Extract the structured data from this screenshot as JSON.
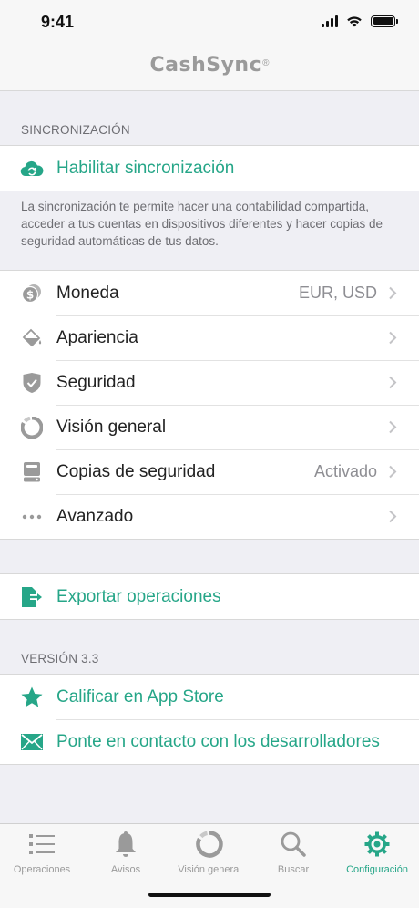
{
  "status_bar": {
    "time": "9:41"
  },
  "header": {
    "title": "CashSync",
    "registered_mark": "®"
  },
  "sync_section": {
    "header": "SINCRONIZACIÓN",
    "enable_label": "Habilitar sincronización",
    "note": "La sincronización te permite hacer una contabilidad compartida, acceder a tus cuentas en dispositivos diferentes y hacer copias de seguridad automáticas de tus datos."
  },
  "settings": {
    "items": [
      {
        "label": "Moneda",
        "value": "EUR, USD",
        "icon": "currency-icon"
      },
      {
        "label": "Apariencia",
        "value": "",
        "icon": "paint-bucket-icon"
      },
      {
        "label": "Seguridad",
        "value": "",
        "icon": "shield-icon"
      },
      {
        "label": "Visión general",
        "value": "",
        "icon": "overview-ring-icon"
      },
      {
        "label": "Copias de seguridad",
        "value": "Activado",
        "icon": "backup-drive-icon"
      },
      {
        "label": "Avanzado",
        "value": "",
        "icon": "more-dots-icon"
      }
    ]
  },
  "export": {
    "label": "Exportar operaciones",
    "icon": "export-icon"
  },
  "version_section": {
    "header": "VERSIÓN 3.3",
    "rate_label": "Calificar en App Store",
    "contact_label": "Ponte en contacto con los desarrolladores"
  },
  "tab_bar": {
    "tabs": [
      {
        "label": "Operaciones",
        "icon": "list-icon"
      },
      {
        "label": "Avisos",
        "icon": "bell-icon"
      },
      {
        "label": "Visión general",
        "icon": "overview-ring-icon"
      },
      {
        "label": "Buscar",
        "icon": "search-icon"
      },
      {
        "label": "Configuración",
        "icon": "gear-icon"
      }
    ],
    "active": "Configuración"
  },
  "colors": {
    "accent": "#26a688",
    "gray_icon": "#9a9a9a",
    "background": "#efeff4"
  }
}
